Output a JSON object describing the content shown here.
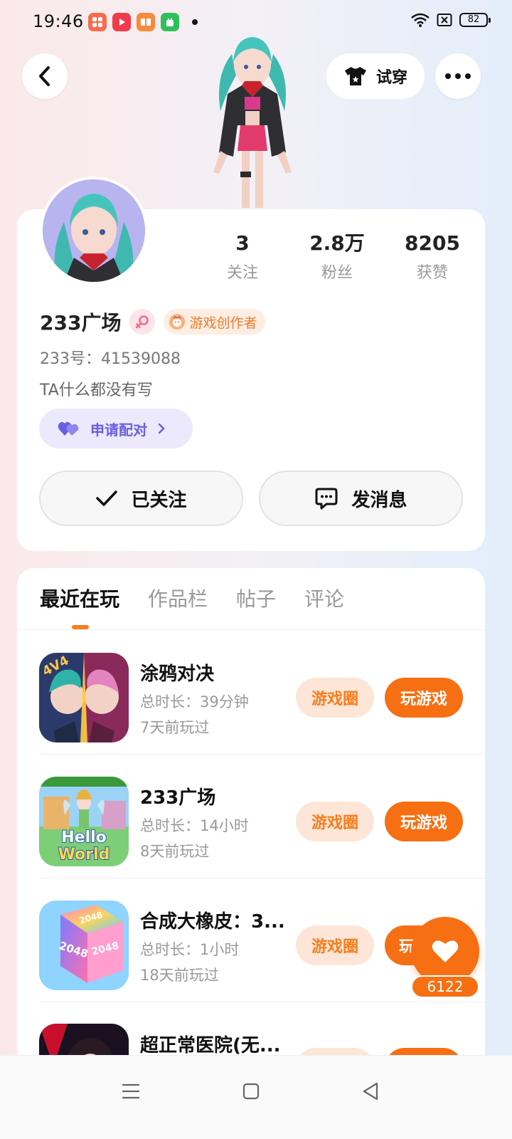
{
  "status_bar": {
    "time": "19:46",
    "battery": "82",
    "app_icons": [
      "album-app-icon",
      "video-app-icon",
      "reader-app-icon",
      "store-app-icon"
    ]
  },
  "top_bar": {
    "try_on_label": "试穿"
  },
  "profile": {
    "stats": [
      {
        "value": "3",
        "label": "关注"
      },
      {
        "value": "2.8万",
        "label": "粉丝"
      },
      {
        "value": "8205",
        "label": "获赞"
      }
    ],
    "name": "233广场",
    "creator_badge": "游戏创作者",
    "user_id": "233号：41539088",
    "bio": "TA什么都没有写",
    "match_label": "申请配对",
    "follow_label": "已关注",
    "message_label": "发消息"
  },
  "tabs": [
    {
      "label": "最近在玩",
      "active": true
    },
    {
      "label": "作品栏",
      "active": false
    },
    {
      "label": "帖子",
      "active": false
    },
    {
      "label": "评论",
      "active": false
    }
  ],
  "games": [
    {
      "title": "涂鸦对决",
      "duration": "总时长：39分钟",
      "last_played": "7天前玩过",
      "circle_label": "游戏圈",
      "play_label": "玩游戏"
    },
    {
      "title": "233广场",
      "duration": "总时长：14小时",
      "last_played": "8天前玩过",
      "circle_label": "游戏圈",
      "play_label": "玩游戏"
    },
    {
      "title": "合成大橡皮：3...",
      "duration": "总时长：1小时",
      "last_played": "18天前玩过",
      "circle_label": "游戏圈",
      "play_label": "玩"
    },
    {
      "title": "超正常医院(无...",
      "duration": "",
      "last_played": "",
      "circle_label": "",
      "play_label": ""
    }
  ],
  "game_icon_text": {
    "graffiti": "4V4",
    "hello": "Hello",
    "world": "World",
    "merge": "2048"
  },
  "like_fab": {
    "count": "6122"
  },
  "colors": {
    "accent": "#f66f12",
    "accent_light": "#fde6d8",
    "match": "#6a5fe3"
  }
}
